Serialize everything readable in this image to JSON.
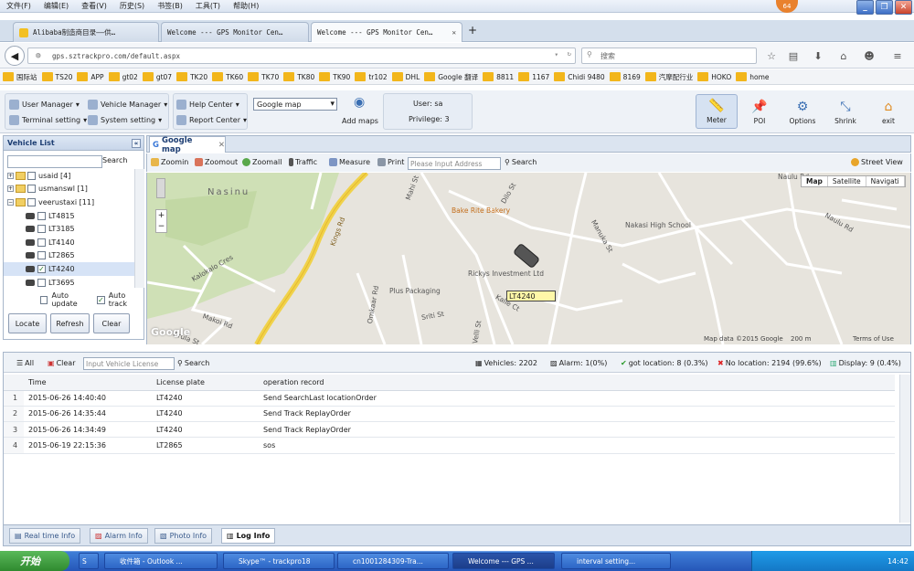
{
  "menu": [
    "文件(F)",
    "编辑(E)",
    "查看(V)",
    "历史(S)",
    "书签(B)",
    "工具(T)",
    "帮助(H)"
  ],
  "badge": "64",
  "tabs": [
    {
      "label": "Alibaba制造商目录——供…",
      "active": false
    },
    {
      "label": "Welcome --- GPS Monitor Cen…",
      "active": false
    },
    {
      "label": "Welcome --- GPS Monitor Cen…",
      "active": true
    }
  ],
  "url": "gps.sztrackpro.com/default.aspx",
  "search_placeholder": "搜索",
  "bookmarks": [
    "国际站",
    "TS20",
    "APP",
    "gt02",
    "gt07",
    "TK20",
    "TK60",
    "TK70",
    "TK80",
    "TK90",
    "tr102",
    "DHL",
    "Google 翻译",
    "8811",
    "1167",
    "Chidi 9480",
    "8169",
    "汽摩配行业",
    "HOKO",
    "home"
  ],
  "toolbar": {
    "user_manager": "User Manager",
    "vehicle_manager": "Vehicle Manager",
    "help_center": "Help Center",
    "terminal_setting": "Terminal setting",
    "system_setting": "System setting",
    "report_center": "Report Center",
    "map_select": "Google map",
    "add_maps": "Add maps",
    "user": "User: sa",
    "privilege": "Privilege: 3",
    "meter": "Meter",
    "poi": "POI",
    "options": "Options",
    "shrink": "Shrink",
    "exit": "exit"
  },
  "vehicle_list": {
    "title": "Vehicle List",
    "search": "Search",
    "nodes": [
      {
        "label": "usaid [4]",
        "type": "group",
        "open": false,
        "checked": false
      },
      {
        "label": "usmanswl [1]",
        "type": "group",
        "open": false,
        "checked": false
      },
      {
        "label": "veerustaxi [11]",
        "type": "group",
        "open": true,
        "checked": false
      },
      {
        "label": "LT4815",
        "type": "car",
        "checked": false
      },
      {
        "label": "LT3185",
        "type": "car",
        "checked": false
      },
      {
        "label": "LT4140",
        "type": "car",
        "checked": false
      },
      {
        "label": "LT2865",
        "type": "car",
        "checked": false
      },
      {
        "label": "LT4240",
        "type": "car",
        "checked": true
      },
      {
        "label": "LT3695",
        "type": "car",
        "checked": false
      }
    ],
    "auto_update": "Auto update",
    "auto_track": "Auto track",
    "locate": "Locate",
    "refresh": "Refresh",
    "clear": "Clear"
  },
  "map": {
    "tab": "Google map",
    "tools": {
      "zoomin": "Zoomin",
      "zoomout": "Zoomout",
      "zoomall": "Zoomall",
      "traffic": "Traffic",
      "measure": "Measure",
      "print": "Print",
      "address_placeholder": "Please Input Address",
      "search": "Search",
      "street_view": "Street View"
    },
    "types": [
      "Map",
      "Satellite",
      "Navigati"
    ],
    "places": [
      "Nasinu",
      "Bake Rite Bakery",
      "Nakasi High School",
      "Rickys Investment Ltd",
      "Plus Packaging",
      "Kings Rd",
      "Dilo St",
      "Naulu Rd",
      "Manuka St",
      "Kalokalo Cres",
      "Omkaar Rd",
      "Sriti St",
      "Makoi Rd",
      "Kalie Ct",
      "Velli St",
      "Wirula St",
      "Mahi St",
      "Naulu Rd"
    ],
    "vehicle_label": "LT4240",
    "copyright": "Map data ©2015 Google",
    "scale": "200 m",
    "terms": "Terms of Use",
    "logo": "Google"
  },
  "log": {
    "all": "All",
    "clear": "Clear",
    "input_placeholder": "Input Vehicle License",
    "search": "Search",
    "stats": {
      "vehicles": "Vehicles: 2202",
      "alarm": "Alarm: 1(0%)",
      "got_location": "got location: 8 (0.3%)",
      "no_location": "No location: 2194 (99.6%)",
      "display": "Display: 9 (0.4%)"
    },
    "columns": [
      "Time",
      "License plate",
      "operation record"
    ],
    "rows": [
      {
        "idx": "1",
        "time": "2015-06-26 14:40:40",
        "plate": "LT4240",
        "op": "Send SearchLast locationOrder"
      },
      {
        "idx": "2",
        "time": "2015-06-26 14:35:44",
        "plate": "LT4240",
        "op": "Send Track ReplayOrder"
      },
      {
        "idx": "3",
        "time": "2015-06-26 14:34:49",
        "plate": "LT4240",
        "op": "Send Track ReplayOrder"
      },
      {
        "idx": "4",
        "time": "2015-06-19 22:15:36",
        "plate": "LT2865",
        "op": "sos"
      }
    ],
    "tabs": [
      "Real time Info",
      "Alarm Info",
      "Photo Info",
      "Log Info"
    ]
  },
  "taskbar": {
    "start": "开始",
    "tasks": [
      "收件箱 - Outlook ...",
      "Skype™ - trackpro18",
      "cn1001284309-Tra...",
      "Welcome --- GPS ...",
      "interval setting..."
    ],
    "clock": "14:42"
  }
}
